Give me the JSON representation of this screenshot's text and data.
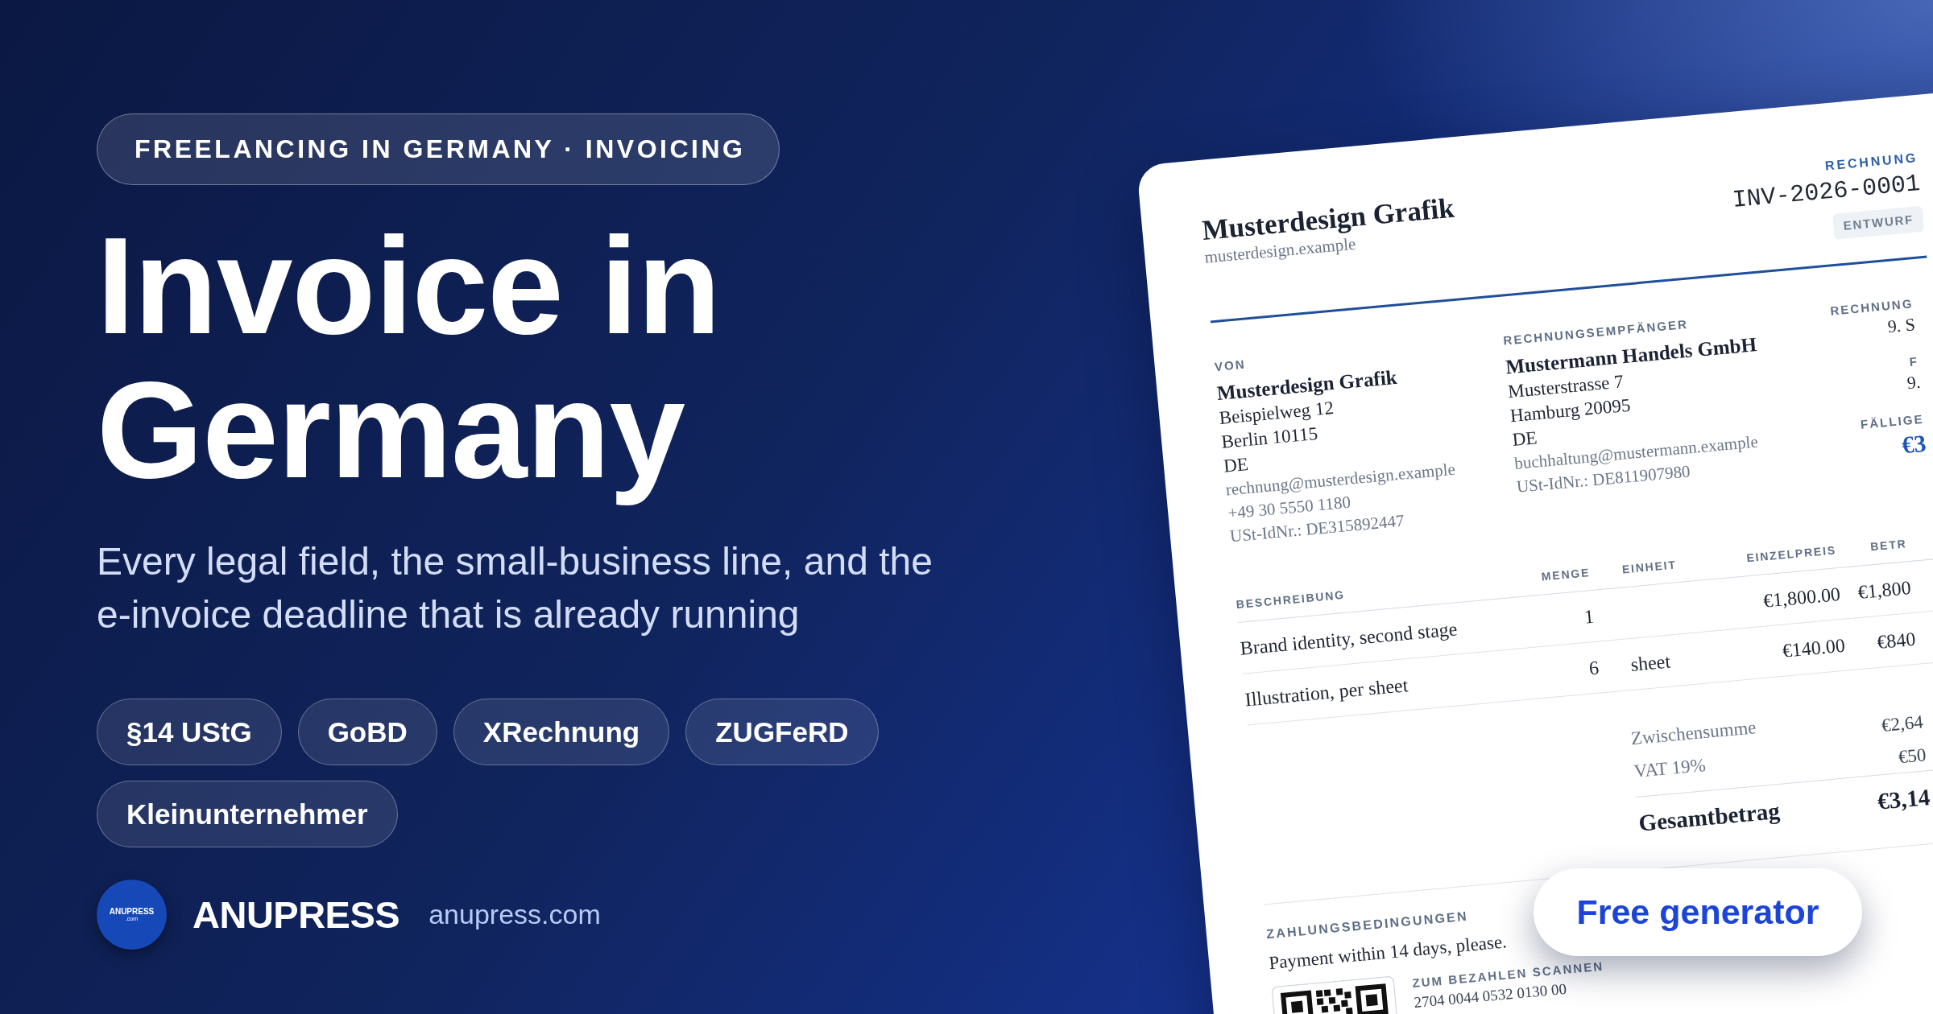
{
  "hero": {
    "eyebrow": "FREELANCING IN GERMANY · INVOICING",
    "title": "Invoice in Germany",
    "subtitle": "Every legal field, the small-business line, and the e-invoice deadline that is already running",
    "tags": [
      "§14 UStG",
      "GoBD",
      "XRechnung",
      "ZUGFeRD",
      "Kleinunternehmer"
    ]
  },
  "brand": {
    "logo_text": "ANUPRESS",
    "logo_subtext": ".com",
    "name": "ANUPRESS",
    "url": "anupress.com"
  },
  "invoice": {
    "company": "Musterdesign Grafik",
    "website": "musterdesign.example",
    "doc_label": "RECHNUNG",
    "number": "INV-2026-0001",
    "status": "ENTWURF",
    "parties": [
      {
        "label": "VON",
        "name": "Musterdesign Grafik",
        "address": [
          "Beispielweg 12",
          "Berlin 10115",
          "DE"
        ],
        "contact": [
          "rechnung@musterdesign.example",
          "+49 30 5550 1180",
          "USt-IdNr.: DE315892447"
        ]
      },
      {
        "label": "RECHNUNGSEMPFÄNGER",
        "name": "Mustermann Handels GmbH",
        "address": [
          "Musterstrasse 7",
          "Hamburg 20095",
          "DE"
        ],
        "contact": [
          "buchhaltung@mustermann.example",
          "USt-IdNr.: DE811907980"
        ]
      }
    ],
    "meta": [
      {
        "label": "RECHNUNG",
        "value": "9. S",
        "kind": "date"
      },
      {
        "label": "F",
        "value": "9.",
        "kind": "date"
      },
      {
        "label": "FÄLLIGE",
        "value": "€3",
        "kind": "amount"
      }
    ],
    "table": {
      "columns": [
        "BESCHREIBUNG",
        "MENGE",
        "EINHEIT",
        "EINZELPREIS",
        "BETR"
      ],
      "rows": [
        {
          "description": "Brand identity, second stage",
          "quantity": "1",
          "unit_price": "€1,800.00",
          "amount": "€1,800"
        },
        {
          "description": "Illustration, per sheet",
          "quantity": "6",
          "unit": "sheet",
          "unit_price": "€140.00",
          "amount": "€840"
        }
      ]
    },
    "totals": [
      {
        "label": "Zwischensumme",
        "value": "€2,64",
        "kind": "subtotal"
      },
      {
        "label": "VAT 19%",
        "value": "€50",
        "kind": "subtotal"
      },
      {
        "label": "Gesamtbetrag",
        "value": "€3,14",
        "kind": "total"
      }
    ],
    "payment": {
      "label": "ZAHLUNGSBEDINGUNGEN",
      "terms": "Payment within 14 days, please.",
      "scan_label": "ZUM BEZAHLEN SCANNEN",
      "account": "2704 0044 0532 0130 00"
    }
  },
  "cta": "Free generator"
}
